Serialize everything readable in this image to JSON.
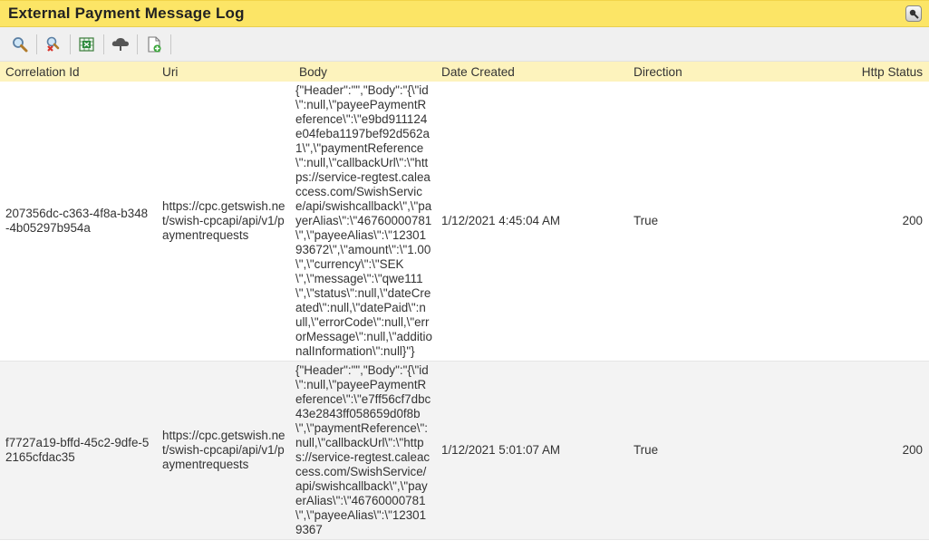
{
  "window": {
    "title": "External Payment Message Log"
  },
  "toolbar": {
    "buttons": [
      {
        "icon": "search-icon"
      },
      {
        "icon": "clear-search-icon"
      },
      {
        "icon": "export-excel-icon"
      },
      {
        "icon": "cloud-upload-icon"
      },
      {
        "icon": "new-document-icon"
      }
    ]
  },
  "table": {
    "columns": {
      "correlation_id": "Correlation Id",
      "uri": "Uri",
      "body": "Body",
      "date_created": "Date Created",
      "direction": "Direction",
      "http_status": "Http Status"
    },
    "rows": [
      {
        "correlation_id": "207356dc-c363-4f8a-b348-4b05297b954a",
        "uri": "https://cpc.getswish.net/swish-cpcapi/api/v1/paymentrequests",
        "body": "{\"Header\":\"\",\"Body\":\"{\\\"id\\\":null,\\\"payeePaymentReference\\\":\\\"e9bd911124e04feba1197bef92d562a1\\\",\\\"paymentReference\\\":null,\\\"callbackUrl\\\":\\\"https://service-regtest.caleaccess.com/SwishService/api/swishcallback\\\",\\\"payerAlias\\\":\\\"46760000781\\\",\\\"payeeAlias\\\":\\\"1230193672\\\",\\\"amount\\\":\\\"1.00\\\",\\\"currency\\\":\\\"SEK\\\",\\\"message\\\":\\\"qwe111\\\",\\\"status\\\":null,\\\"dateCreated\\\":null,\\\"datePaid\\\":null,\\\"errorCode\\\":null,\\\"errorMessage\\\":null,\\\"additionalInformation\\\":null}\"}",
        "date_created": "1/12/2021 4:45:04 AM",
        "direction": "True",
        "http_status": "200"
      },
      {
        "correlation_id": "f7727a19-bffd-45c2-9dfe-52165cfdac35",
        "uri": "https://cpc.getswish.net/swish-cpcapi/api/v1/paymentrequests",
        "body": "{\"Header\":\"\",\"Body\":\"{\\\"id\\\":null,\\\"payeePaymentReference\\\":\\\"e7ff56cf7dbc43e2843ff058659d0f8b\\\",\\\"paymentReference\\\":null,\\\"callbackUrl\\\":\\\"https://service-regtest.caleaccess.com/SwishService/api/swishcallback\\\",\\\"payerAlias\\\":\\\"46760000781\\\",\\\"payeeAlias\\\":\\\"123019367",
        "date_created": "1/12/2021 5:01:07 AM",
        "direction": "True",
        "http_status": "200"
      }
    ]
  }
}
